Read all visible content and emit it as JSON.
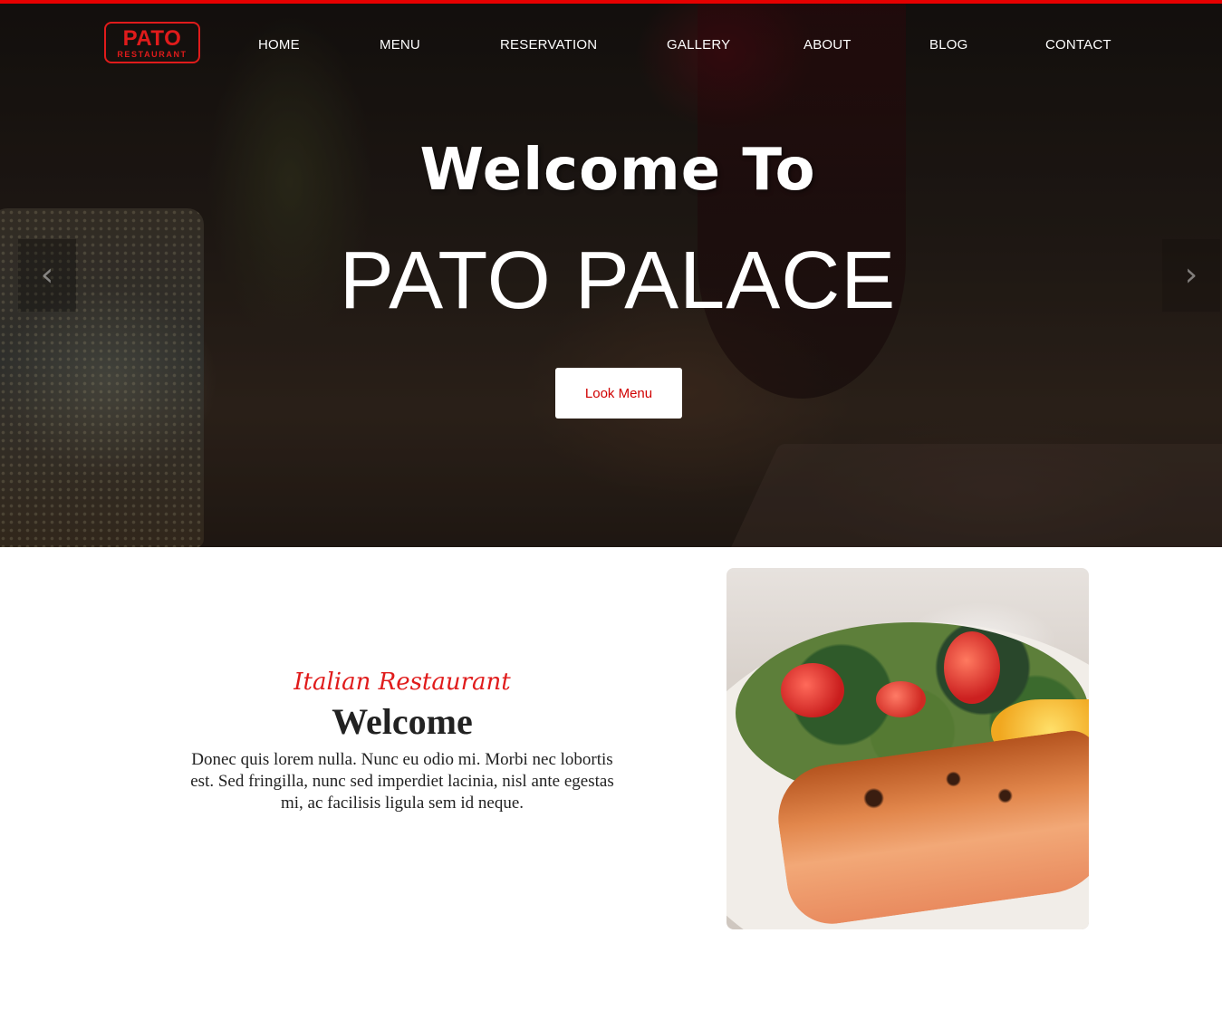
{
  "brand": {
    "name": "PATO",
    "tagline": "RESTAURANT",
    "color": "#e01b1b"
  },
  "nav": {
    "items": [
      "HOME",
      "MENU",
      "RESERVATION",
      "GALLERY",
      "ABOUT",
      "BLOG",
      "CONTACT"
    ]
  },
  "hero": {
    "welcome": "Welcome To",
    "title": "PATO PALACE",
    "cta_label": "Look Menu",
    "prev_icon": "chevron-left-icon",
    "next_icon": "chevron-right-icon",
    "prev_glyph": "‹",
    "next_glyph": "›"
  },
  "about": {
    "subtitle": "Italian Restaurant",
    "heading": "Welcome",
    "paragraph": "Donec quis lorem nulla. Nunc eu odio mi. Morbi nec lobortis est. Sed fringilla, nunc sed imperdiet lacinia, nisl ante egestas mi, ac facilisis ligula sem id neque."
  },
  "colors": {
    "accent": "#e01b1b",
    "text": "#222222"
  }
}
